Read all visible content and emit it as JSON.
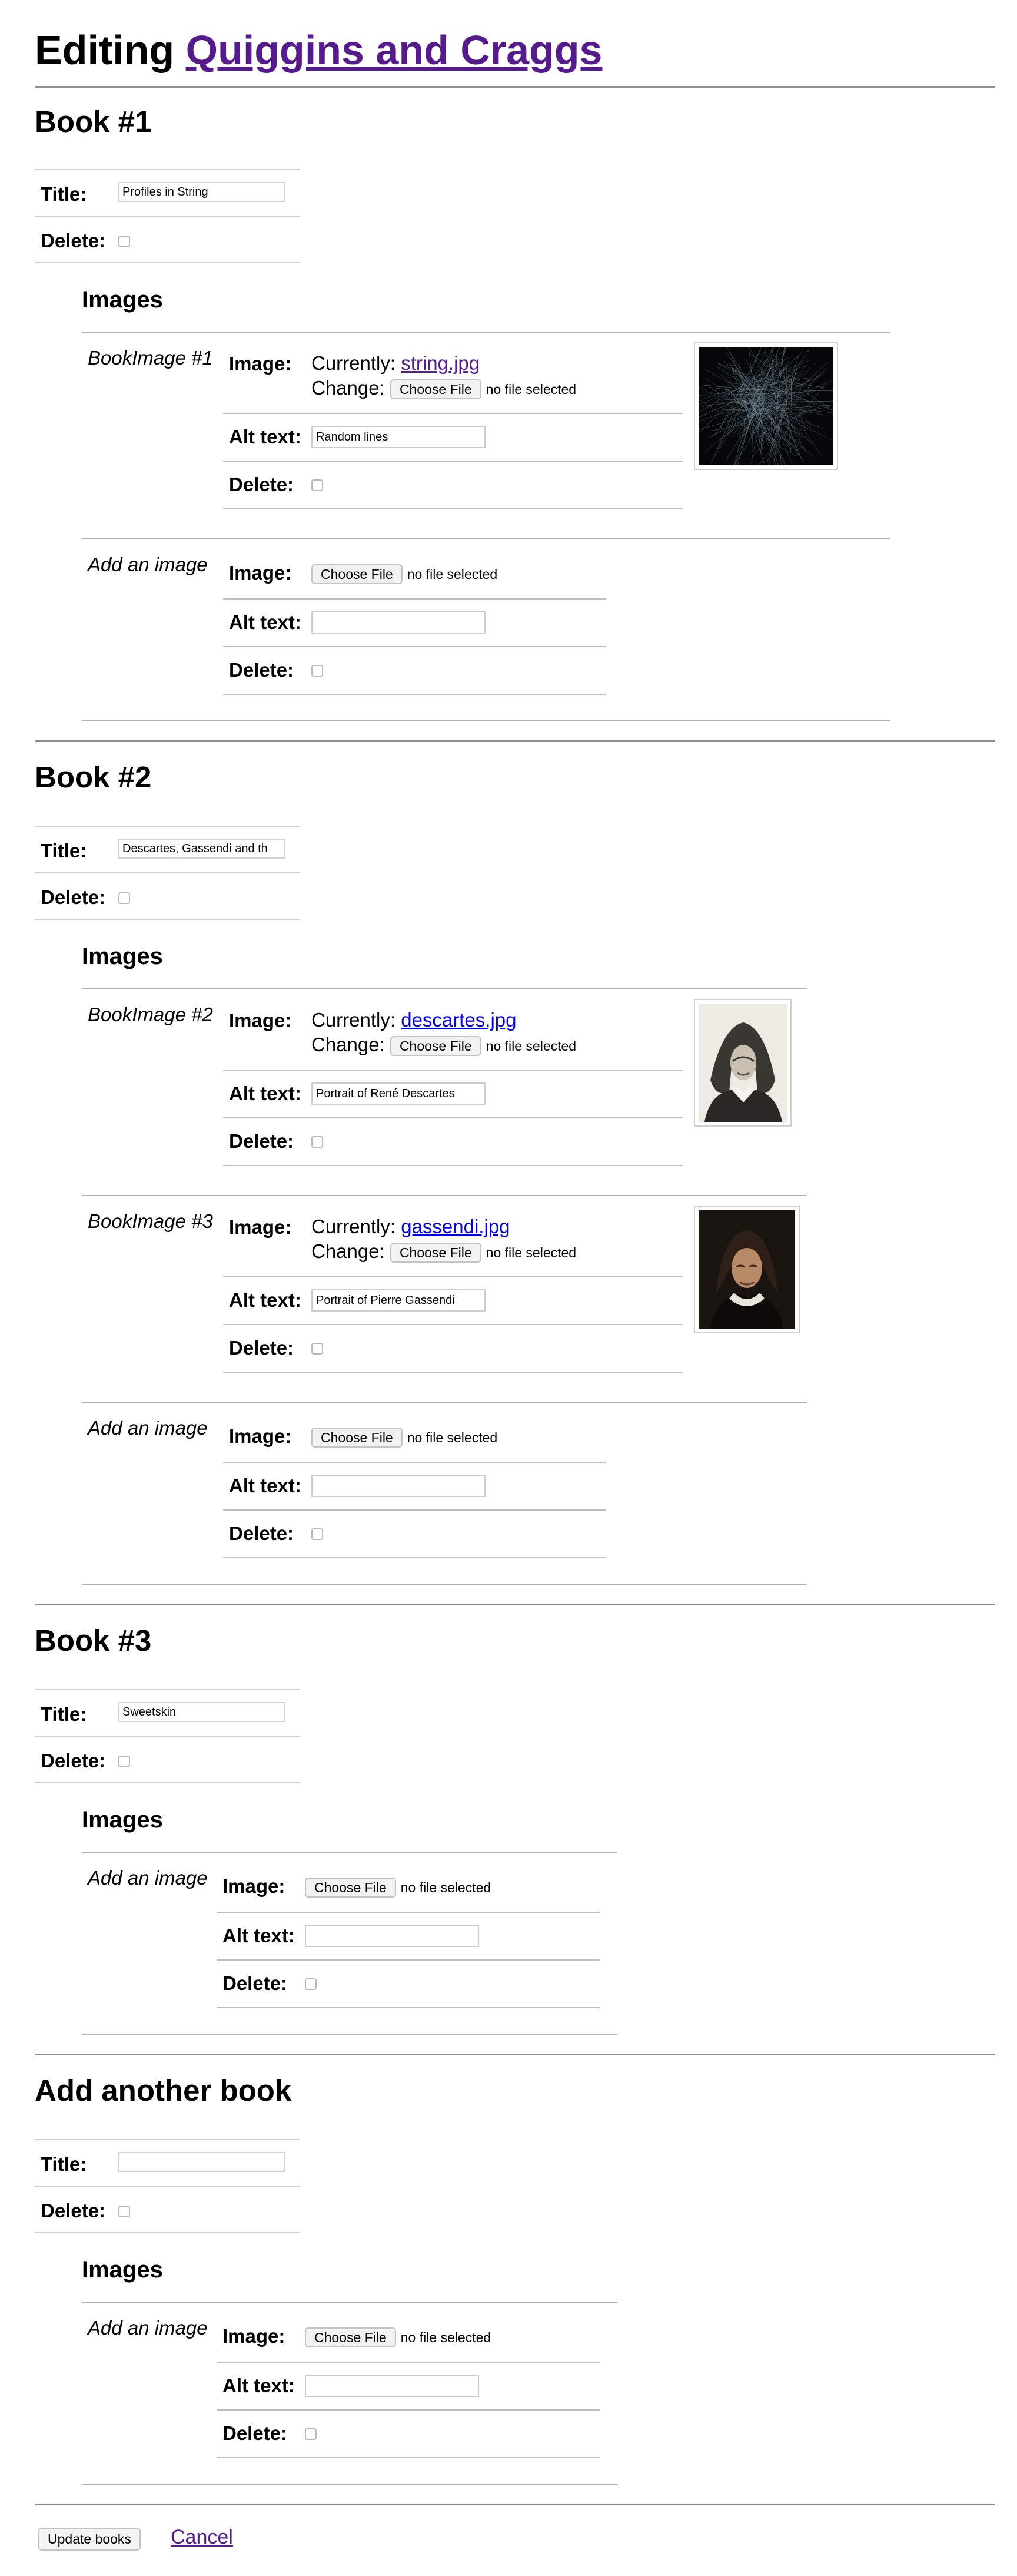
{
  "page": {
    "title_prefix": "Editing",
    "title_link": "Quiggins and Craggs"
  },
  "labels": {
    "title": "Title:",
    "delete": "Delete:",
    "images": "Images",
    "image": "Image:",
    "alt_text": "Alt text:",
    "currently": "Currently:",
    "change": "Change:",
    "choose_file": "Choose File",
    "no_file": "no file selected",
    "add_image": "Add an image"
  },
  "books": [
    {
      "heading": "Book #1",
      "title_value": "Profiles in String",
      "images": [
        {
          "label": "BookImage #1",
          "filename": "string.jpg",
          "alt": "Random lines",
          "thumb": "lines-image"
        }
      ]
    },
    {
      "heading": "Book #2",
      "title_value": "Descartes, Gassendi and th",
      "images": [
        {
          "label": "BookImage #2",
          "filename": "descartes.jpg",
          "alt": "Portrait of René Descartes",
          "thumb": "descartes-portrait"
        },
        {
          "label": "BookImage #3",
          "filename": "gassendi.jpg",
          "alt": "Portrait of Pierre Gassendi",
          "thumb": "gassendi-portrait"
        }
      ]
    },
    {
      "heading": "Book #3",
      "title_value": "Sweetskin",
      "images": []
    },
    {
      "heading": "Add another book",
      "title_value": "",
      "images": []
    }
  ],
  "footer": {
    "update_label": "Update books",
    "cancel_label": "Cancel"
  }
}
